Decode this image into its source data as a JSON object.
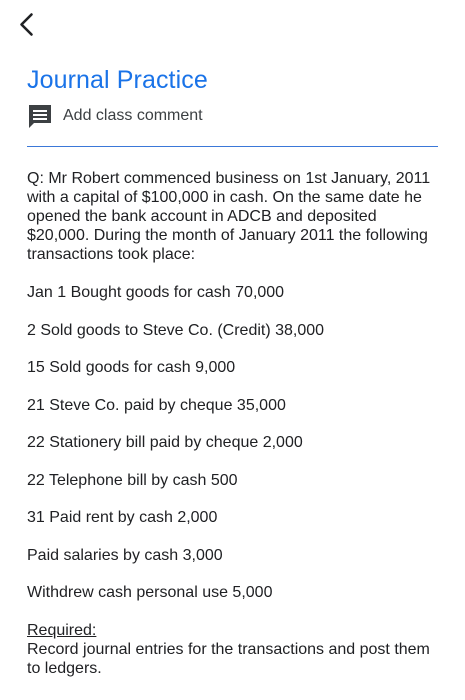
{
  "header": {
    "back_icon": "chevron-left-icon"
  },
  "page": {
    "title": "Journal Practice"
  },
  "comment": {
    "icon": "comment-icon",
    "label": "Add class comment"
  },
  "content": {
    "question": "Q: Mr Robert commenced business on 1st January, 2011 with a capital of $100,000 in cash. On the same date he opened the bank account in ADCB and deposited $20,000. During the month of January 2011 the following transactions took place:",
    "transactions": [
      "Jan 1 Bought goods for cash 70,000",
      "2 Sold goods to Steve Co. (Credit) 38,000",
      "15 Sold goods for cash 9,000",
      "21 Steve Co. paid by cheque 35,000",
      "22 Stationery bill paid by cheque 2,000",
      "22 Telephone bill by cash 500",
      "31 Paid rent by cash 2,000",
      "Paid salaries by cash 3,000",
      "Withdrew cash personal use 5,000"
    ],
    "required_heading": "Required:",
    "required_text": "Record journal entries for the transactions and post them to ledgers."
  },
  "colors": {
    "accent": "#1a73e8",
    "divider": "#3b78d8",
    "text": "#202124",
    "icon": "#3c4043"
  }
}
